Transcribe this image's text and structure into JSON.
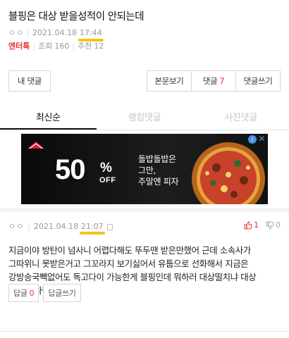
{
  "post": {
    "title": "블핑은 대상 받을성적이 안되는데",
    "author": "ㅇㅇ",
    "date": "2021.04.18",
    "time": "17:44",
    "category": "엔터톡",
    "views_label": "조회",
    "views": "160",
    "recommend_label": "추천",
    "recommend": "12"
  },
  "actions": {
    "my_comments": "내 댓글",
    "view_post": "본문보기",
    "comments_label": "댓글",
    "comments_count": "7",
    "write_comment": "댓글쓰기"
  },
  "tabs": [
    {
      "label": "최신순",
      "active": true
    },
    {
      "label": "랭킹댓글",
      "active": false
    },
    {
      "label": "사진댓글",
      "active": false
    }
  ],
  "ad": {
    "percent": "50",
    "percent_sign": "%",
    "off": "OFF",
    "line1": "돌밥돌밥은",
    "line2": "그만,",
    "line3": "주말엔 피자",
    "info_icon": "i",
    "close_icon": "✕"
  },
  "comment": {
    "author": "ㅇㅇ",
    "date": "2021.04.18",
    "time": "21:07",
    "up": "1",
    "down": "0",
    "body": "지금이야 방탄이 넘사니 어렵다해도 뚜두땐 받은만했어 근데 소속사가 그따위니 못받은거고 그꼬라지 보기싫어서 유툽으로 선화해서 지금은 강방송국빽없어도 독고다이 가능한게 블핑인데 뭐하러 대상떨치냐 대상 니그들 다해",
    "reply_label": "답글",
    "reply_count": "0",
    "write_reply": "답글쓰기"
  },
  "colors": {
    "accent_red": "#e8342a",
    "underline_yellow": "#f5c518",
    "ad_background": "#141414"
  }
}
